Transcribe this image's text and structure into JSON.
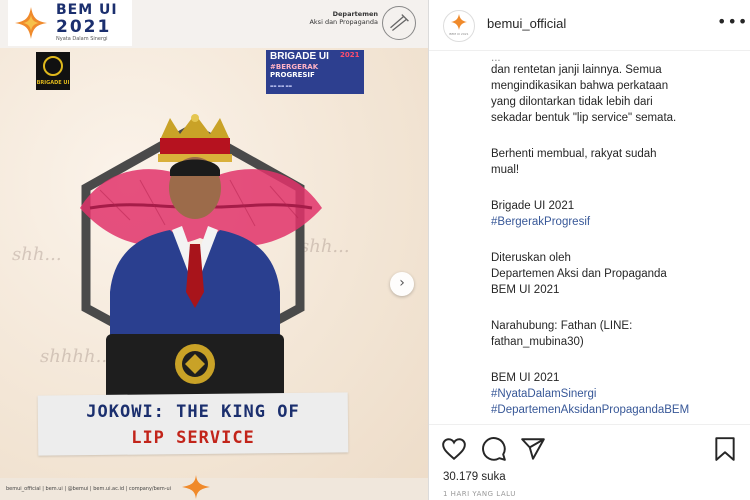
{
  "post_image": {
    "logo": {
      "title": "BEM UI",
      "year": "2021",
      "tagline": "Nyata Dalam Sinergi"
    },
    "department": {
      "line1": "Departemen",
      "line2": "Aksi dan Propaganda"
    },
    "ui_badge_text": "BRIGADE UI",
    "brigade_badge": {
      "title": "BRIGADE UI",
      "year": "2021",
      "hash1": "#BERGERAK",
      "hash2": "PROGRESIF"
    },
    "background_words": [
      "shh...",
      "shh...",
      "shhhh..."
    ],
    "caption_banner": {
      "line1": "JOKOWI: THE KING OF",
      "line2": "LIP SERVICE"
    },
    "footer_text": "bemui_official  |  bem.ui  |  @bemui  |  bem.ui.ac.id  |  company/bem-ui",
    "colors": {
      "navy": "#1b2f6e",
      "red": "#c2241a",
      "brigade_blue": "#2d3f8f"
    }
  },
  "carousel": {
    "next_icon": "chevron-right-icon",
    "next_glyph": "›"
  },
  "instagram": {
    "username": "bemui_official",
    "avatar_text": "BEM UI 2021",
    "more_glyph": "•••",
    "caption": {
      "cut_line": "...",
      "p1_l1": "dan rentetan janji lainnya. Semua",
      "p1_l2": "mengindikasikan bahwa perkataan",
      "p1_l3": "yang dilontarkan tidak lebih dari",
      "p1_l4": "sekadar bentuk \"lip service\" semata.",
      "p2_l1": "Berhenti membual, rakyat sudah",
      "p2_l2": "mual!",
      "p3_l1": "Brigade UI 2021",
      "p3_l2": "#BergerakProgresif",
      "p4_l1": "Diteruskan oleh",
      "p4_l2": "Departemen Aksi dan Propaganda",
      "p4_l3": "BEM UI 2021",
      "p5_l1": "Narahubung: Fathan (LINE:",
      "p5_l2": "fathan_mubina30)",
      "p6_l1": "BEM UI 2021",
      "p6_l2": "#NyataDalamSinergi",
      "p6_l3": "#DepartemenAksidanPropagandaBEM"
    },
    "likes": "30.179 suka",
    "date": "1 HARI YANG LALU",
    "icons": [
      "heart-icon",
      "comment-icon",
      "share-icon",
      "bookmark-icon"
    ],
    "colors": {
      "hashtag": "#385898",
      "text": "#262626"
    }
  }
}
